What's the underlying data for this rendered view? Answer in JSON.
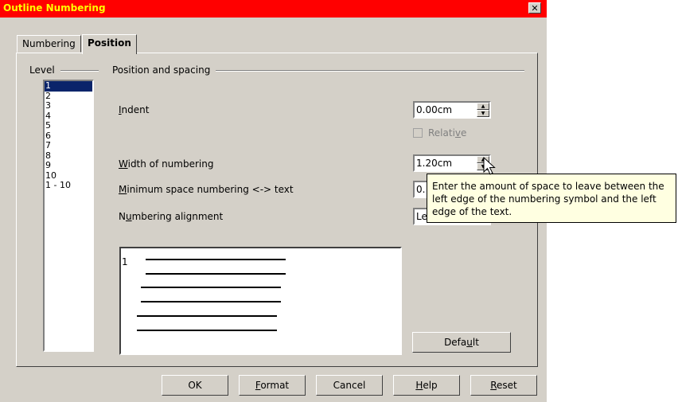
{
  "window": {
    "title": "Outline Numbering",
    "close_glyph": "✕"
  },
  "tabs": [
    {
      "label": "Numbering",
      "active": false
    },
    {
      "label": "Position",
      "active": true
    }
  ],
  "level": {
    "group_label": "Level",
    "items": [
      "1",
      "2",
      "3",
      "4",
      "5",
      "6",
      "7",
      "8",
      "9",
      "10",
      "1 - 10"
    ],
    "selected": "1"
  },
  "position": {
    "group_label": "Position and spacing",
    "indent": {
      "label_u": "I",
      "label_rest": "ndent",
      "value": "0.00cm"
    },
    "relative": {
      "label_pre": "Relati",
      "label_u": "v",
      "label_post": "e",
      "checked": false,
      "enabled": false
    },
    "width": {
      "label_u": "W",
      "label_rest": "idth of numbering",
      "value": "1.20cm"
    },
    "min_space": {
      "label_u": "M",
      "label_rest": "inimum space numbering <-> text",
      "value": "0."
    },
    "alignment": {
      "label_pre": "N",
      "label_u": "u",
      "label_post": "mbering alignment",
      "value": "Le"
    },
    "preview_number": "1",
    "default_button": {
      "pre": "Defa",
      "u": "u",
      "post": "lt"
    }
  },
  "tooltip": "Enter the amount of space to leave between the left edge of the numbering symbol and the left edge of the text.",
  "buttons": {
    "ok": "OK",
    "format": {
      "u": "F",
      "rest": "ormat"
    },
    "cancel": "Cancel",
    "help": {
      "u": "H",
      "rest": "elp"
    },
    "reset": {
      "u": "R",
      "rest": "eset"
    }
  },
  "colors": {
    "titlebar": "#ff0000",
    "title_text": "#ffff00",
    "dialog_bg": "#d4d0c8",
    "tooltip_bg": "#ffffe1",
    "selection": "#0a246a"
  }
}
